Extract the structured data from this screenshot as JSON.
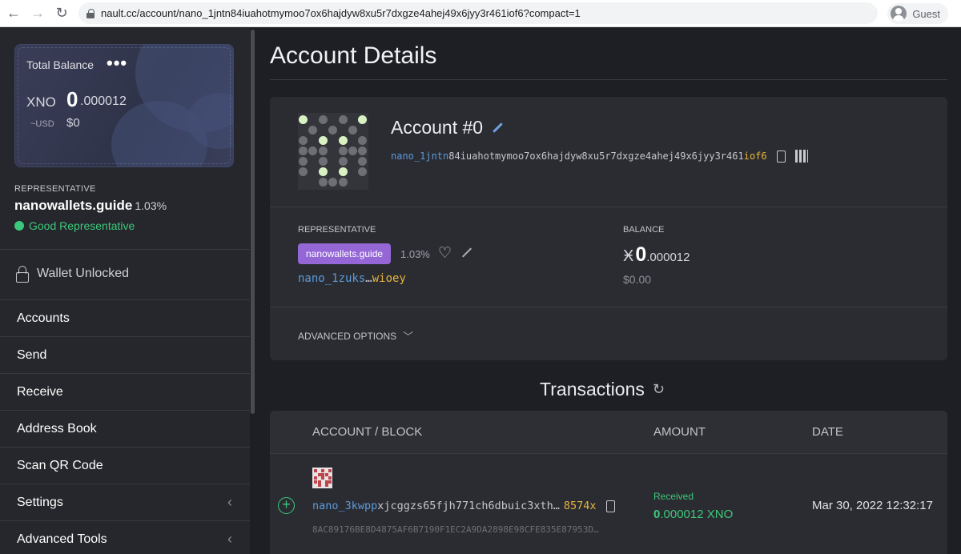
{
  "browser": {
    "url": "nault.cc/account/nano_1jntn84iuahotmymoo7ox6hajdyw8xu5r7dxgze4ahej49x6jyy3r461iof6?compact=1",
    "profile": "Guest"
  },
  "sidebar": {
    "balance": {
      "label": "Total Balance",
      "more": "•••",
      "currency": "XNO",
      "integer": "0",
      "fraction": ".000012",
      "fiat_currency": "~USD",
      "fiat_value": "$0"
    },
    "representative": {
      "title": "REPRESENTATIVE",
      "name": "nanowallets.guide",
      "weight": "1.03%",
      "status": "Good Representative"
    },
    "wallet_status": "Wallet Unlocked",
    "menu": [
      {
        "label": "Accounts"
      },
      {
        "label": "Send"
      },
      {
        "label": "Receive"
      },
      {
        "label": "Address Book"
      },
      {
        "label": "Scan QR Code"
      },
      {
        "label": "Settings"
      },
      {
        "label": "Advanced Tools"
      }
    ]
  },
  "main": {
    "page_title": "Account Details",
    "account": {
      "name": "Account #0",
      "address_prefix": "nano_1jntn",
      "address_middle": "84iuahotmymoo7ox6hajdyw8xu5r7dxgze4ahej49x6jyy3r461",
      "address_suffix": "iof6"
    },
    "representative": {
      "title": "REPRESENTATIVE",
      "label": "nanowallets.guide",
      "weight": "1.03%",
      "address_prefix": "nano_1zuks",
      "address_ellipsis": "…",
      "address_suffix": "wioey"
    },
    "balance": {
      "title": "BALANCE",
      "symbol": "Ӿ",
      "integer": "0",
      "fraction": ".000012",
      "fiat": "$0.00"
    },
    "advanced_options": "ADVANCED OPTIONS",
    "transactions": {
      "title": "Transactions",
      "headers": [
        "ACCOUNT / BLOCK",
        "AMOUNT",
        "DATE"
      ],
      "rows": [
        {
          "address_prefix": "nano_3kwpp",
          "address_middle": "xjcggzs65fjh771ch6dbuic3xth…",
          "address_suffix": "8574x",
          "hash": "8AC89176BE8D4875AF6B7190F1EC2A9DA2898E98CFE835E87953D…",
          "status": "Received",
          "amount_integer": "0",
          "amount_fraction": ".000012",
          "amount_unit": "XNO",
          "date": "Mar 30, 2022 12:32:17"
        }
      ]
    }
  },
  "colors": {
    "accent_purple": "#9466d6",
    "success_green": "#3cc87a",
    "address_blue": "#5b9bd9",
    "address_gold": "#e6b43c"
  }
}
